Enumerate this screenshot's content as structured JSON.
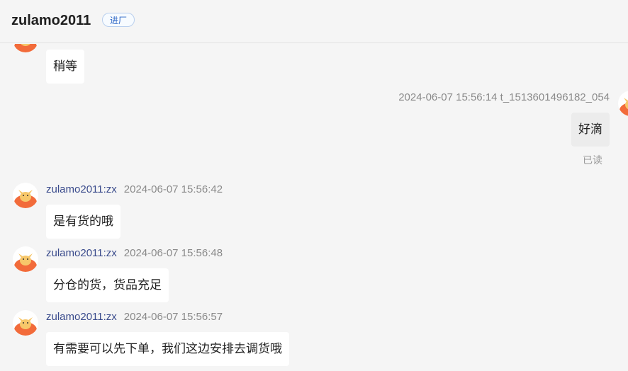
{
  "header": {
    "title": "zulamo2011",
    "tag": "进厂"
  },
  "messages": [
    {
      "text": "稍等"
    },
    {
      "meta": "2024-06-07 15:56:14  t_1513601496182_054",
      "text": "好滴",
      "status": "已读"
    },
    {
      "sender": "zulamo2011:zx",
      "time": "2024-06-07 15:56:42",
      "text": "是有货的哦"
    },
    {
      "sender": "zulamo2011:zx",
      "time": "2024-06-07 15:56:48",
      "text": "分仓的货，货品充足"
    },
    {
      "sender": "zulamo2011:zx",
      "time": "2024-06-07 15:56:57",
      "text": "有需要可以先下单，我们这边安排去调货哦"
    }
  ],
  "colors": {
    "avatar_primary": "#f26b3a",
    "avatar_secondary": "#f7c76a",
    "sender_link": "#3a4b8c"
  }
}
